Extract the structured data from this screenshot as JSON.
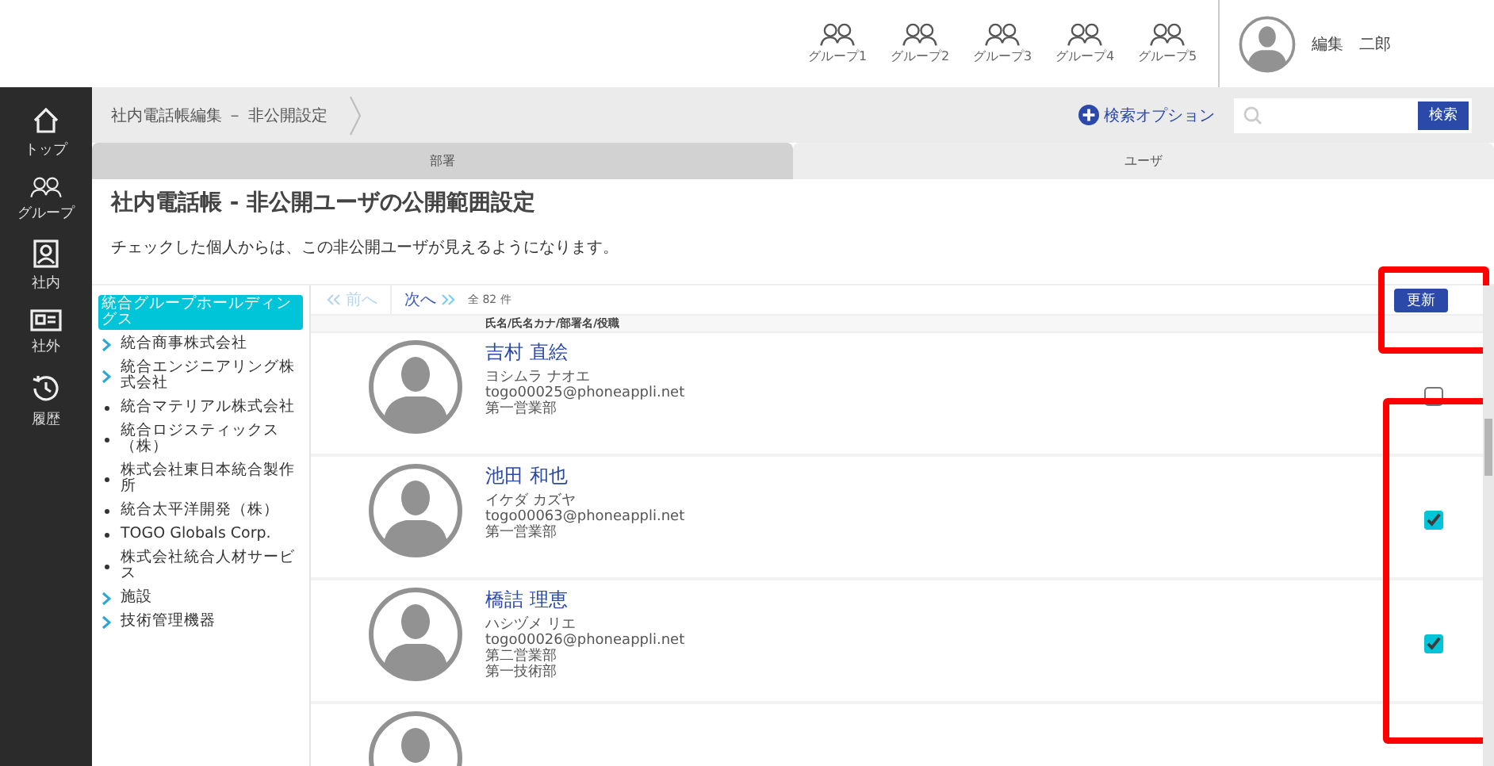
{
  "header": {
    "groups": [
      {
        "label": "グループ1"
      },
      {
        "label": "グループ2"
      },
      {
        "label": "グループ3"
      },
      {
        "label": "グループ4"
      },
      {
        "label": "グループ5"
      }
    ],
    "user_name": "編集　二郎"
  },
  "sidebar": {
    "items": [
      {
        "kind": "home",
        "label": "トップ"
      },
      {
        "kind": "group",
        "label": "グループ"
      },
      {
        "kind": "internal",
        "label": "社内"
      },
      {
        "kind": "external",
        "label": "社外"
      },
      {
        "kind": "history",
        "label": "履歴"
      }
    ]
  },
  "breadcrumb": "社内電話帳編集 － 非公開設定",
  "search": {
    "option_label": "検索オプション",
    "button": "検索"
  },
  "tabs": [
    {
      "label": "部署",
      "selected": true
    },
    {
      "label": "ユーザ",
      "selected": false
    }
  ],
  "title": "社内電話帳 - 非公開ユーザの公開範囲設定",
  "description": "チェックした個人からは、この非公開ユーザが見えるようになります。",
  "tree": {
    "items": [
      {
        "label": "統合グループホールディングス",
        "selected": true,
        "kind": "root"
      },
      {
        "label": "統合商事株式会社",
        "selected": false,
        "kind": "branch"
      },
      {
        "label": "統合エンジニアリング株式会社",
        "selected": false,
        "kind": "branch"
      },
      {
        "label": "統合マテリアル株式会社",
        "selected": false,
        "kind": "leaf"
      },
      {
        "label": "統合ロジスティックス（株）",
        "selected": false,
        "kind": "leaf"
      },
      {
        "label": "株式会社東日本統合製作所",
        "selected": false,
        "kind": "leaf"
      },
      {
        "label": "統合太平洋開発（株）",
        "selected": false,
        "kind": "leaf"
      },
      {
        "label": "TOGO Globals Corp.",
        "selected": false,
        "kind": "leaf"
      },
      {
        "label": "株式会社統合人材サービス",
        "selected": false,
        "kind": "leaf"
      },
      {
        "label": "施設",
        "selected": false,
        "kind": "branch"
      },
      {
        "label": "技術管理機器",
        "selected": false,
        "kind": "branch"
      }
    ]
  },
  "pager": {
    "prev": "前へ",
    "prev_disabled": true,
    "next": "次へ",
    "count": "全 82 件"
  },
  "update_button": "更新",
  "table": {
    "column_header": "氏名/氏名カナ/部署名/役職",
    "rows": [
      {
        "name": "吉村 直絵",
        "kana": "ヨシムラ ナオエ",
        "email": "togo00025@phoneappli.net",
        "departments": [
          "第一営業部"
        ],
        "checked": false
      },
      {
        "name": "池田 和也",
        "kana": "イケダ カズヤ",
        "email": "togo00063@phoneappli.net",
        "departments": [
          "第一営業部"
        ],
        "checked": true
      },
      {
        "name": "橋詰 理恵",
        "kana": "ハシヅメ リエ",
        "email": "togo00026@phoneappli.net",
        "departments": [
          "第二営業部",
          "第一技術部"
        ],
        "checked": true
      }
    ]
  }
}
